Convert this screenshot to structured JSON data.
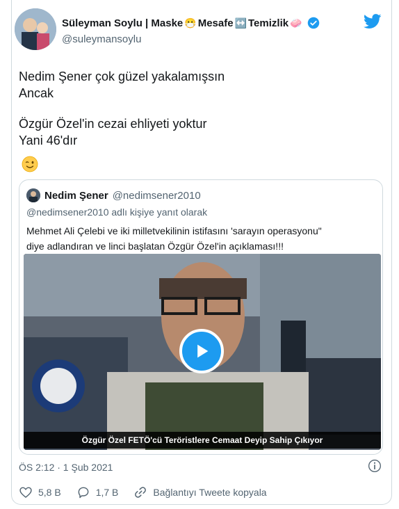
{
  "author": {
    "name_part1": "Süleyman Soylu | Maske",
    "emoji_mask": "😷",
    "name_part2": "Mesafe",
    "emoji_arrows": "↔️",
    "name_part3": "Temizlik",
    "emoji_soap": "🧼",
    "handle": "@suleymansoylu"
  },
  "tweet": {
    "lines": [
      "Nedim Şener çok güzel yakalamışsın",
      "Ancak",
      "Özgür Özel'in cezai ehliyeti yoktur",
      "Yani 46'dır"
    ],
    "emoji": "😉"
  },
  "quoted": {
    "name": "Nedim Şener",
    "handle": "@nedimsener2010",
    "reply_to": "@nedimsener2010 adlı kişiye yanıt olarak",
    "text_lines": [
      "Mehmet Ali Çelebi ve iki milletvekilinin istifasını 'sarayın operasyonu\"",
      "diye adlandıran ve linci başlatan Özgür Özel'in açıklaması!!!"
    ],
    "video_caption": "Özgür Özel FETÖ'cü Teröristlere Cemaat Deyip Sahip Çıkıyor"
  },
  "meta": {
    "timestamp": "ÖS 2:12 · 1 Şub 2021"
  },
  "actions": {
    "likes": "5,8 B",
    "replies": "1,7 B",
    "copy_link": "Bağlantıyı Tweete kopyala"
  },
  "colors": {
    "brand_blue": "#1d9bf0",
    "muted_text": "#536471"
  }
}
